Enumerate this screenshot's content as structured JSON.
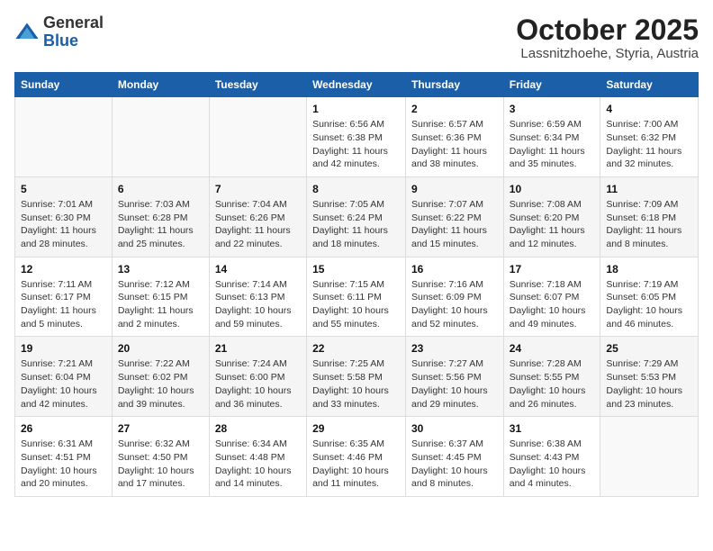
{
  "header": {
    "logo": {
      "general": "General",
      "blue": "Blue"
    },
    "title": "October 2025",
    "subtitle": "Lassnitzhoehe, Styria, Austria"
  },
  "weekdays": [
    "Sunday",
    "Monday",
    "Tuesday",
    "Wednesday",
    "Thursday",
    "Friday",
    "Saturday"
  ],
  "weeks": [
    [
      {
        "day": "",
        "sunrise": "",
        "sunset": "",
        "daylight": ""
      },
      {
        "day": "",
        "sunrise": "",
        "sunset": "",
        "daylight": ""
      },
      {
        "day": "",
        "sunrise": "",
        "sunset": "",
        "daylight": ""
      },
      {
        "day": "1",
        "sunrise": "Sunrise: 6:56 AM",
        "sunset": "Sunset: 6:38 PM",
        "daylight": "Daylight: 11 hours and 42 minutes."
      },
      {
        "day": "2",
        "sunrise": "Sunrise: 6:57 AM",
        "sunset": "Sunset: 6:36 PM",
        "daylight": "Daylight: 11 hours and 38 minutes."
      },
      {
        "day": "3",
        "sunrise": "Sunrise: 6:59 AM",
        "sunset": "Sunset: 6:34 PM",
        "daylight": "Daylight: 11 hours and 35 minutes."
      },
      {
        "day": "4",
        "sunrise": "Sunrise: 7:00 AM",
        "sunset": "Sunset: 6:32 PM",
        "daylight": "Daylight: 11 hours and 32 minutes."
      }
    ],
    [
      {
        "day": "5",
        "sunrise": "Sunrise: 7:01 AM",
        "sunset": "Sunset: 6:30 PM",
        "daylight": "Daylight: 11 hours and 28 minutes."
      },
      {
        "day": "6",
        "sunrise": "Sunrise: 7:03 AM",
        "sunset": "Sunset: 6:28 PM",
        "daylight": "Daylight: 11 hours and 25 minutes."
      },
      {
        "day": "7",
        "sunrise": "Sunrise: 7:04 AM",
        "sunset": "Sunset: 6:26 PM",
        "daylight": "Daylight: 11 hours and 22 minutes."
      },
      {
        "day": "8",
        "sunrise": "Sunrise: 7:05 AM",
        "sunset": "Sunset: 6:24 PM",
        "daylight": "Daylight: 11 hours and 18 minutes."
      },
      {
        "day": "9",
        "sunrise": "Sunrise: 7:07 AM",
        "sunset": "Sunset: 6:22 PM",
        "daylight": "Daylight: 11 hours and 15 minutes."
      },
      {
        "day": "10",
        "sunrise": "Sunrise: 7:08 AM",
        "sunset": "Sunset: 6:20 PM",
        "daylight": "Daylight: 11 hours and 12 minutes."
      },
      {
        "day": "11",
        "sunrise": "Sunrise: 7:09 AM",
        "sunset": "Sunset: 6:18 PM",
        "daylight": "Daylight: 11 hours and 8 minutes."
      }
    ],
    [
      {
        "day": "12",
        "sunrise": "Sunrise: 7:11 AM",
        "sunset": "Sunset: 6:17 PM",
        "daylight": "Daylight: 11 hours and 5 minutes."
      },
      {
        "day": "13",
        "sunrise": "Sunrise: 7:12 AM",
        "sunset": "Sunset: 6:15 PM",
        "daylight": "Daylight: 11 hours and 2 minutes."
      },
      {
        "day": "14",
        "sunrise": "Sunrise: 7:14 AM",
        "sunset": "Sunset: 6:13 PM",
        "daylight": "Daylight: 10 hours and 59 minutes."
      },
      {
        "day": "15",
        "sunrise": "Sunrise: 7:15 AM",
        "sunset": "Sunset: 6:11 PM",
        "daylight": "Daylight: 10 hours and 55 minutes."
      },
      {
        "day": "16",
        "sunrise": "Sunrise: 7:16 AM",
        "sunset": "Sunset: 6:09 PM",
        "daylight": "Daylight: 10 hours and 52 minutes."
      },
      {
        "day": "17",
        "sunrise": "Sunrise: 7:18 AM",
        "sunset": "Sunset: 6:07 PM",
        "daylight": "Daylight: 10 hours and 49 minutes."
      },
      {
        "day": "18",
        "sunrise": "Sunrise: 7:19 AM",
        "sunset": "Sunset: 6:05 PM",
        "daylight": "Daylight: 10 hours and 46 minutes."
      }
    ],
    [
      {
        "day": "19",
        "sunrise": "Sunrise: 7:21 AM",
        "sunset": "Sunset: 6:04 PM",
        "daylight": "Daylight: 10 hours and 42 minutes."
      },
      {
        "day": "20",
        "sunrise": "Sunrise: 7:22 AM",
        "sunset": "Sunset: 6:02 PM",
        "daylight": "Daylight: 10 hours and 39 minutes."
      },
      {
        "day": "21",
        "sunrise": "Sunrise: 7:24 AM",
        "sunset": "Sunset: 6:00 PM",
        "daylight": "Daylight: 10 hours and 36 minutes."
      },
      {
        "day": "22",
        "sunrise": "Sunrise: 7:25 AM",
        "sunset": "Sunset: 5:58 PM",
        "daylight": "Daylight: 10 hours and 33 minutes."
      },
      {
        "day": "23",
        "sunrise": "Sunrise: 7:27 AM",
        "sunset": "Sunset: 5:56 PM",
        "daylight": "Daylight: 10 hours and 29 minutes."
      },
      {
        "day": "24",
        "sunrise": "Sunrise: 7:28 AM",
        "sunset": "Sunset: 5:55 PM",
        "daylight": "Daylight: 10 hours and 26 minutes."
      },
      {
        "day": "25",
        "sunrise": "Sunrise: 7:29 AM",
        "sunset": "Sunset: 5:53 PM",
        "daylight": "Daylight: 10 hours and 23 minutes."
      }
    ],
    [
      {
        "day": "26",
        "sunrise": "Sunrise: 6:31 AM",
        "sunset": "Sunset: 4:51 PM",
        "daylight": "Daylight: 10 hours and 20 minutes."
      },
      {
        "day": "27",
        "sunrise": "Sunrise: 6:32 AM",
        "sunset": "Sunset: 4:50 PM",
        "daylight": "Daylight: 10 hours and 17 minutes."
      },
      {
        "day": "28",
        "sunrise": "Sunrise: 6:34 AM",
        "sunset": "Sunset: 4:48 PM",
        "daylight": "Daylight: 10 hours and 14 minutes."
      },
      {
        "day": "29",
        "sunrise": "Sunrise: 6:35 AM",
        "sunset": "Sunset: 4:46 PM",
        "daylight": "Daylight: 10 hours and 11 minutes."
      },
      {
        "day": "30",
        "sunrise": "Sunrise: 6:37 AM",
        "sunset": "Sunset: 4:45 PM",
        "daylight": "Daylight: 10 hours and 8 minutes."
      },
      {
        "day": "31",
        "sunrise": "Sunrise: 6:38 AM",
        "sunset": "Sunset: 4:43 PM",
        "daylight": "Daylight: 10 hours and 4 minutes."
      },
      {
        "day": "",
        "sunrise": "",
        "sunset": "",
        "daylight": ""
      }
    ]
  ]
}
